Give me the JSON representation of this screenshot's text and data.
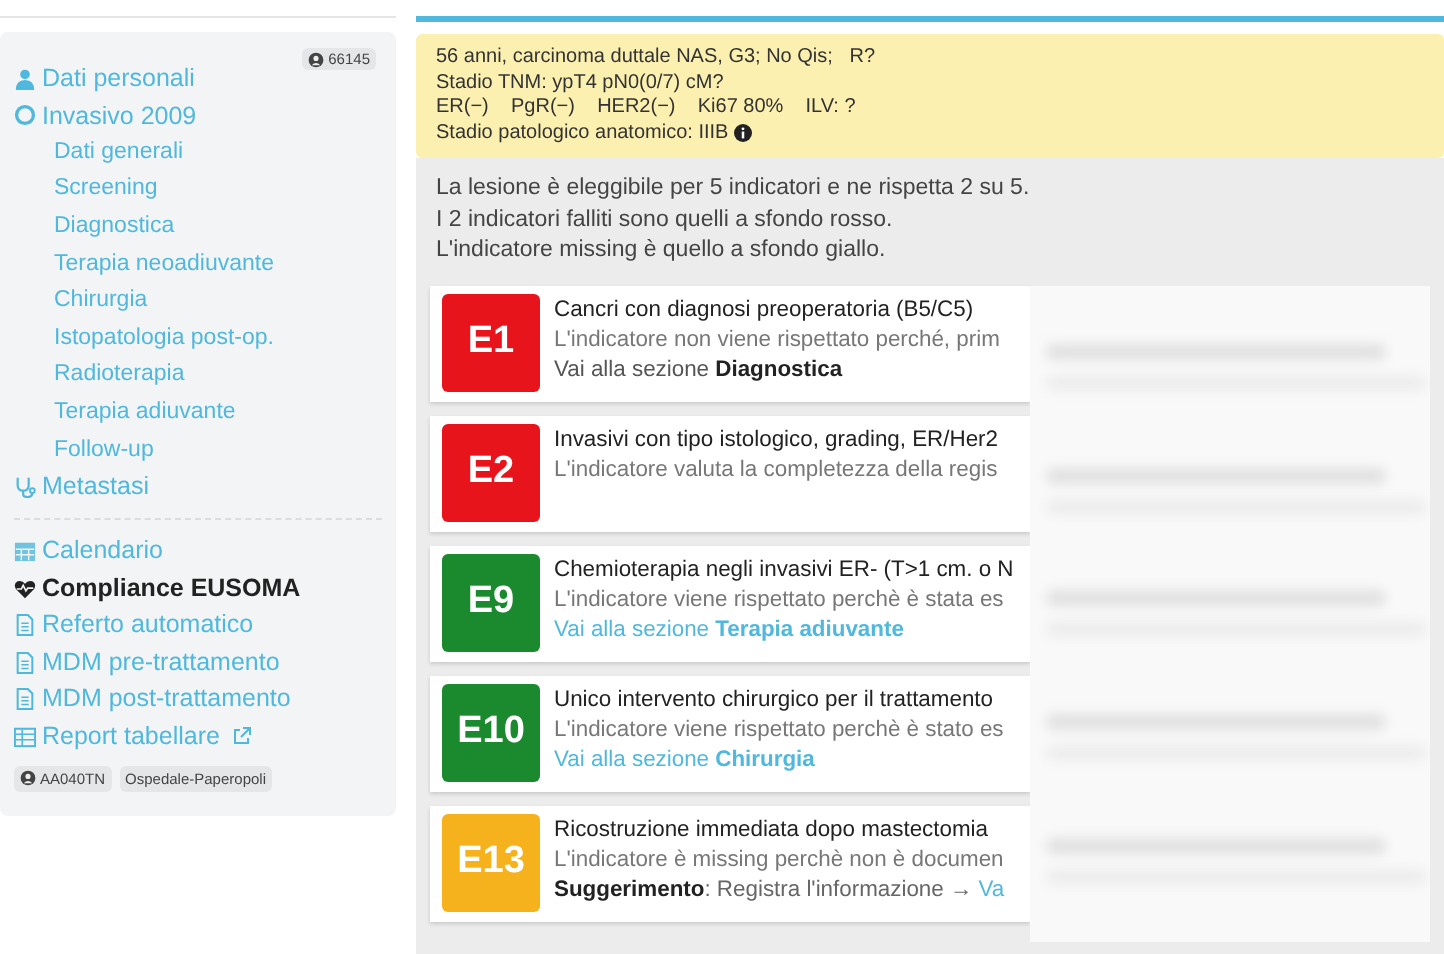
{
  "sidebar": {
    "patient_badge": "66145",
    "tree": [
      {
        "label": "Dati personali",
        "kind": "user",
        "selected": false
      },
      {
        "label": "Invasivo 2009",
        "kind": "circle",
        "selected": false,
        "children": [
          {
            "label": "Dati generali",
            "selected": false
          },
          {
            "label": "Screening",
            "selected": false
          },
          {
            "label": "Diagnostica",
            "selected": false
          },
          {
            "label": "Terapia neoadiuvante",
            "selected": false
          },
          {
            "label": "Chirurgia",
            "selected": false
          },
          {
            "label": "Istopatologia post-op.",
            "selected": false
          },
          {
            "label": "Radioterapia",
            "selected": false
          },
          {
            "label": "Terapia adiuvante",
            "selected": false
          },
          {
            "label": "Follow-up",
            "selected": false
          }
        ]
      },
      {
        "label": "Metastasi",
        "kind": "stethoscope",
        "selected": false
      }
    ],
    "tools": [
      {
        "label": "Calendario",
        "kind": "calendar",
        "selected": false,
        "external": false
      },
      {
        "label": "Compliance EUSOMA",
        "kind": "heart",
        "selected": true,
        "external": false
      },
      {
        "label": "Referto automatico",
        "kind": "file",
        "selected": false,
        "external": false
      },
      {
        "label": "MDM pre-trattamento",
        "kind": "file",
        "selected": false,
        "external": false
      },
      {
        "label": "MDM post-trattamento",
        "kind": "file",
        "selected": false,
        "external": false
      },
      {
        "label": "Report tabellare",
        "kind": "table",
        "selected": false,
        "external": true
      }
    ],
    "footer_badges": [
      {
        "text": "AA040TN",
        "user": true
      },
      {
        "text": "Ospedale-Paperopoli",
        "user": false
      }
    ]
  },
  "summary": {
    "lines": [
      "56 anni, carcinoma duttale NAS, G3; No Qis;   R?",
      "Stadio TNM: ypT4 pN0(0/7) cM?",
      "ER(−)    PgR(−)    HER2(−)    Ki67 80%    ILV: ?",
      "Stadio patologico anatomico: IIIB"
    ]
  },
  "intro": [
    "La lesione è eleggibile per 5 indicatori e ne rispetta 2 su 5.",
    "I 2 indicatori falliti sono quelli a sfondo rosso.",
    "L'indicatore missing è quello a sfondo giallo."
  ],
  "indicators": [
    {
      "code": "E1",
      "kind": "failed",
      "title": "Cancri con diagnosi preoperatoria (B5/C5)",
      "text": "L'indicatore non viene rispettato perché, prim",
      "link": {
        "prefix": "Vai alla sezione",
        "section": "Diagnostica"
      }
    },
    {
      "code": "E2",
      "kind": "failed",
      "title": "Invasivi con tipo istologico, grading, ER/Her2",
      "text": "L'indicatore valuta la completezza della regis"
    },
    {
      "code": "E9",
      "kind": "passed",
      "title": "Chemioterapia negli invasivi ER- (T>1 cm. o N",
      "text": "L'indicatore viene rispettato perchè è stata es",
      "link": {
        "prefix": "Vai alla sezione",
        "section": "Terapia adiuvante"
      }
    },
    {
      "code": "E10",
      "kind": "passed",
      "title": "Unico intervento chirurgico per il trattamento",
      "text": "L'indicatore viene rispettato perchè è stato es",
      "link": {
        "prefix": "Vai alla sezione",
        "section": "Chirurgia"
      }
    },
    {
      "code": "E13",
      "kind": "missing",
      "title": "Ricostruzione immediata dopo mastectomia",
      "text": "L'indicatore è missing perchè non è documen",
      "suggestion": {
        "label": "Suggerimento",
        "text": ": Registra l'informazione →",
        "link": "Va"
      }
    }
  ]
}
